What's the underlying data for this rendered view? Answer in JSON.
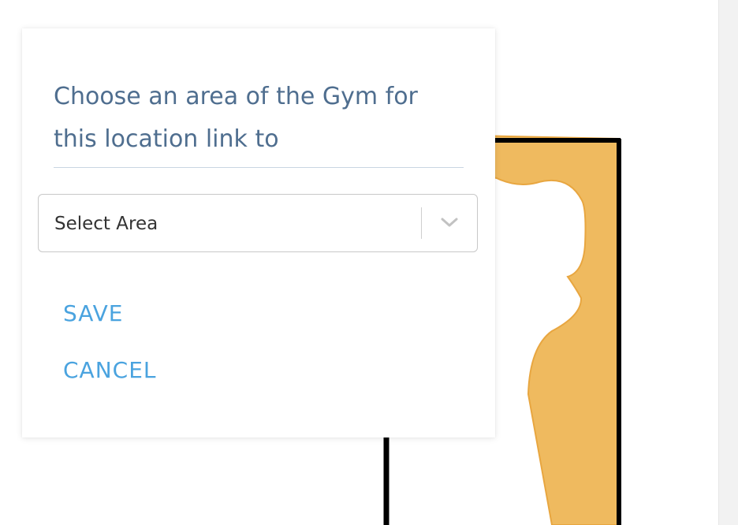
{
  "dialog": {
    "title_line1": "Choose an area of the Gym for",
    "title_line2": "this location link to",
    "select": {
      "value": "Select Area"
    },
    "save_label": "SAVE",
    "cancel_label": "CANCEL"
  },
  "colors": {
    "title": "#4f6e8f",
    "action": "#4aa3df",
    "floor_area": "#efba5f",
    "floor_area_border": "#e8a640",
    "wall": "#000000"
  },
  "icons": {
    "dropdown": "chevron-down-icon"
  }
}
